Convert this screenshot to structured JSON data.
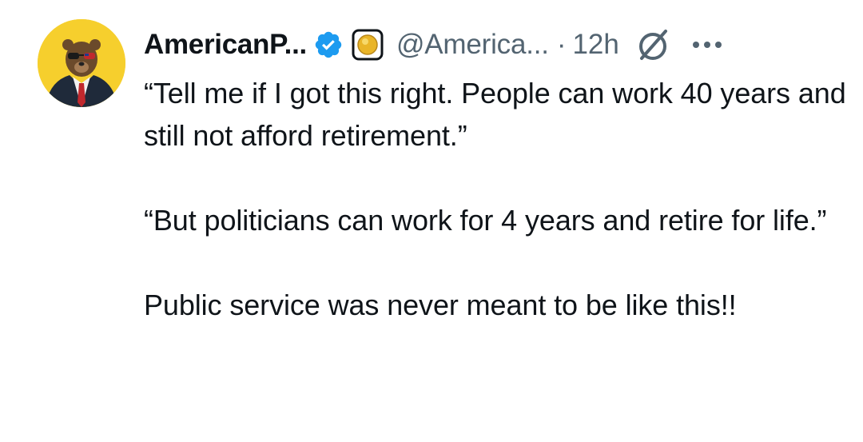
{
  "tweet": {
    "author": {
      "display_name": "AmericanP...",
      "handle": "@America...",
      "verified": true,
      "avatar_icon": "bear-in-suit-avatar",
      "affiliation_badge_icon": "gold-circle-badge-icon"
    },
    "separator": "·",
    "timestamp": "12h",
    "grok_icon": "grok-icon",
    "more_icon": "more-options-icon",
    "body": {
      "paragraphs": [
        "“Tell me if I got this right. People can work 40 years and still not afford retirement.”",
        "“But politicians can work for 4 years and retire for life.”",
        "Public service was never meant to be like this!!"
      ]
    }
  },
  "colors": {
    "text_primary": "#0f1419",
    "text_secondary": "#536471",
    "verified_blue": "#1d9bf0",
    "avatar_background": "#f6cf2d"
  }
}
